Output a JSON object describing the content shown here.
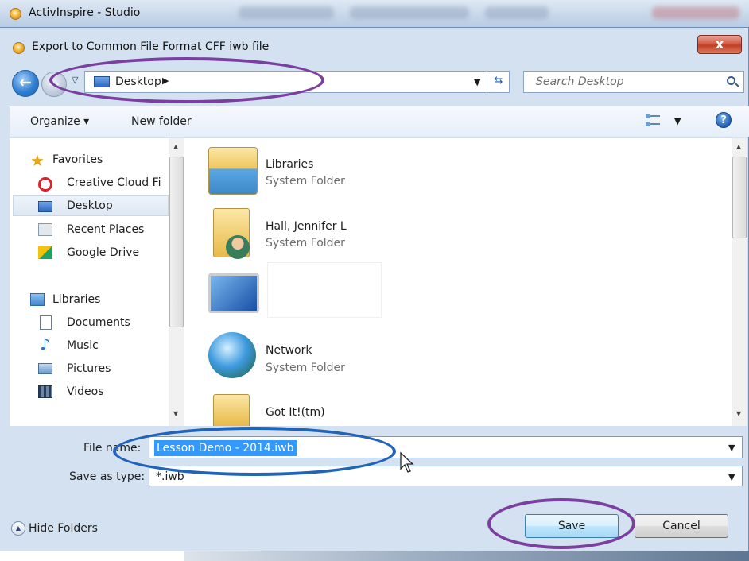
{
  "app": {
    "title": "ActivInspire - Studio"
  },
  "dialog": {
    "title": "Export to Common File Format CFF iwb file",
    "close_label": "x"
  },
  "address_bar": {
    "location": "Desktop",
    "search_placeholder": "Search Desktop"
  },
  "toolbar": {
    "organize_label": "Organize ▾",
    "new_folder_label": "New folder",
    "help_label": "?"
  },
  "nav": {
    "favorites_label": "Favorites",
    "items_favorites": [
      "Creative Cloud Fi",
      "Desktop",
      "Recent Places",
      "Google Drive"
    ],
    "libraries_label": "Libraries",
    "items_libraries": [
      "Documents",
      "Music",
      "Pictures",
      "Videos"
    ]
  },
  "files": [
    {
      "name": "Libraries",
      "type": "System Folder"
    },
    {
      "name": "Hall, Jennifer L",
      "type": "System Folder"
    },
    {
      "name": "",
      "type": ""
    },
    {
      "name": "Network",
      "type": "System Folder"
    },
    {
      "name": "Got It!(tm)",
      "type": ""
    }
  ],
  "form": {
    "file_name_label": "File name:",
    "file_name_value": "Lesson Demo - 2014.iwb",
    "save_type_label": "Save as type:",
    "save_type_value": "*.iwb"
  },
  "footer": {
    "hide_folders_label": "Hide Folders",
    "save_label": "Save",
    "cancel_label": "Cancel"
  },
  "colors": {
    "annotation_purple": "#7b3fa0",
    "annotation_blue": "#2163b8",
    "selection_blue": "#3399ff"
  }
}
